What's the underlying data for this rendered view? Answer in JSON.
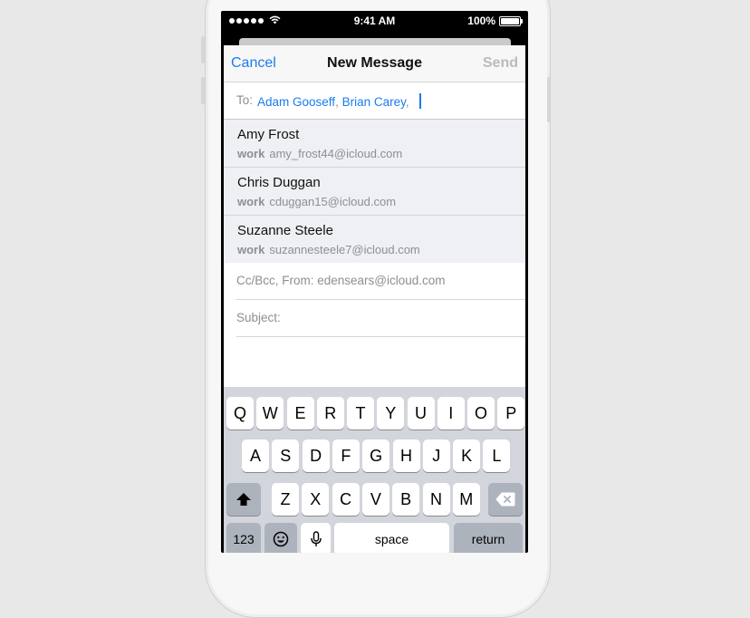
{
  "status": {
    "time": "9:41 AM",
    "battery": "100%",
    "battery_level": 1.0
  },
  "nav": {
    "cancel": "Cancel",
    "title": "New Message",
    "send": "Send"
  },
  "to": {
    "label": "To:",
    "recipients": [
      "Adam Gooseff",
      "Brian Carey"
    ],
    "separator": ","
  },
  "suggestions": [
    {
      "name": "Amy Frost",
      "type": "work",
      "email": "amy_frost44@icloud.com"
    },
    {
      "name": "Chris Duggan",
      "type": "work",
      "email": "cduggan15@icloud.com"
    },
    {
      "name": "Suzanne Steele",
      "type": "work",
      "email": "suzannesteele7@icloud.com"
    }
  ],
  "fields": {
    "ccbcc": "Cc/Bcc, From: edensears@icloud.com",
    "subject": "Subject:"
  },
  "keyboard": {
    "row1": [
      "Q",
      "W",
      "E",
      "R",
      "T",
      "Y",
      "U",
      "I",
      "O",
      "P"
    ],
    "row2": [
      "A",
      "S",
      "D",
      "F",
      "G",
      "H",
      "J",
      "K",
      "L"
    ],
    "row3": [
      "Z",
      "X",
      "C",
      "V",
      "B",
      "N",
      "M"
    ],
    "numbers": "123",
    "space": "space",
    "return": "return",
    "shift_icon": "shift-arrow-icon",
    "delete_icon": "backspace-icon",
    "emoji_icon": "emoji-icon",
    "mic_icon": "microphone-icon"
  },
  "colors": {
    "accent": "#1a7cf0",
    "suggestions_bg": "#eff0f4",
    "keyboard_bg": "#d2d5db"
  }
}
